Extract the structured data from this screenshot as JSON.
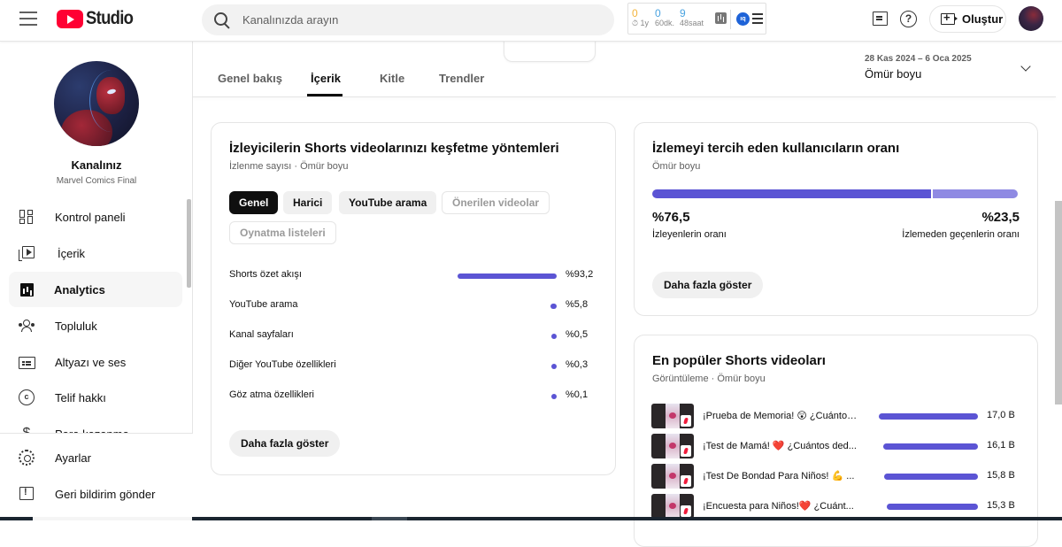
{
  "topbar": {
    "app_name": "Studio",
    "search_placeholder": "Kanalınızda arayın",
    "extension": {
      "stats": [
        {
          "value": "0",
          "label": "⏱ 1y",
          "color": "#f3b43c"
        },
        {
          "value": "0",
          "label": "60dk.",
          "color": "#4aa3e0"
        },
        {
          "value": "9",
          "label": "48saat",
          "color": "#4aa3e0"
        }
      ],
      "badge_label": "ıq"
    },
    "create_label": "Oluştur"
  },
  "sidebar": {
    "channel_title": "Kanalınız",
    "channel_name": "Marvel Comics Final",
    "items": [
      {
        "label": "Kontrol paneli",
        "icon": "dashboard-icon",
        "active": false
      },
      {
        "label": "İçerik",
        "icon": "content-icon",
        "active": false
      },
      {
        "label": "Analytics",
        "icon": "analytics-icon",
        "active": true
      },
      {
        "label": "Topluluk",
        "icon": "community-icon",
        "active": false
      },
      {
        "label": "Altyazı ve ses",
        "icon": "subtitles-icon",
        "active": false
      },
      {
        "label": "Telif hakkı",
        "icon": "copyright-icon",
        "active": false
      },
      {
        "label": "Para kazanma",
        "icon": "monetization-icon",
        "active": false
      }
    ],
    "bottom_items": [
      {
        "label": "Ayarlar",
        "icon": "settings-icon"
      },
      {
        "label": "Geri bildirim gönder",
        "icon": "feedback-icon"
      }
    ]
  },
  "main": {
    "tabs": [
      {
        "label": "Genel bakış",
        "active": false
      },
      {
        "label": "İçerik",
        "active": true
      },
      {
        "label": "Kitle",
        "active": false
      },
      {
        "label": "Trendler",
        "active": false
      }
    ],
    "date_range": "28 Kas 2024 – 6 Oca 2025",
    "date_label": "Ömür boyu",
    "discovery_card": {
      "title": "İzleyicilerin Shorts videolarınızı keşfetme yöntemleri",
      "subtitle": "İzlenme sayısı · Ömür boyu",
      "chips": [
        {
          "label": "Genel",
          "state": "selected"
        },
        {
          "label": "Harici",
          "state": "normal"
        },
        {
          "label": "YouTube arama",
          "state": "normal"
        },
        {
          "label": "Önerilen videolar",
          "state": "disabled"
        },
        {
          "label": "Oynatma listeleri",
          "state": "disabled"
        }
      ],
      "rows": [
        {
          "label": "Shorts özet akışı",
          "value": "%93,2",
          "percent": 93.2
        },
        {
          "label": "YouTube arama",
          "value": "%5,8",
          "percent": 5.8
        },
        {
          "label": "Kanal sayfaları",
          "value": "%0,5",
          "percent": 0.5
        },
        {
          "label": "Diğer YouTube özellikleri",
          "value": "%0,3",
          "percent": 0.3
        },
        {
          "label": "Göz atma özellikleri",
          "value": "%0,1",
          "percent": 0.1
        }
      ],
      "more_label": "Daha fazla göster"
    },
    "viewed_card": {
      "title": "İzlemeyi tercih eden kullanıcıların oranı",
      "subtitle": "Ömür boyu",
      "viewed_percent": 76.5,
      "viewed_value": "%76,5",
      "viewed_label": "İzleyenlerin oranı",
      "swiped_value": "%23,5",
      "swiped_label": "İzlemeden geçenlerin oranı",
      "colors": {
        "viewed": "#5b54d4",
        "swiped": "#8f8ae3"
      },
      "more_label": "Daha fazla göster"
    },
    "top_shorts_card": {
      "title": "En popüler Shorts videoları",
      "subtitle": "Görüntüleme · Ömür boyu",
      "videos": [
        {
          "title": "¡Prueba de Memoria! 😲 ¿Cuántos...",
          "value": "17,0 B",
          "views_thousands": 17.0
        },
        {
          "title": "¡Test de Mamá! ❤️ ¿Cuántos ded...",
          "value": "16,1 B",
          "views_thousands": 16.1
        },
        {
          "title": "¡Test De Bondad Para Niños! 💪 ...",
          "value": "15,8 B",
          "views_thousands": 15.8
        },
        {
          "title": "¡Encuesta para Niños!❤️ ¿Cuánt...",
          "value": "15,3 B",
          "views_thousands": 15.3
        }
      ]
    }
  },
  "accent_color": "#5b54d4"
}
